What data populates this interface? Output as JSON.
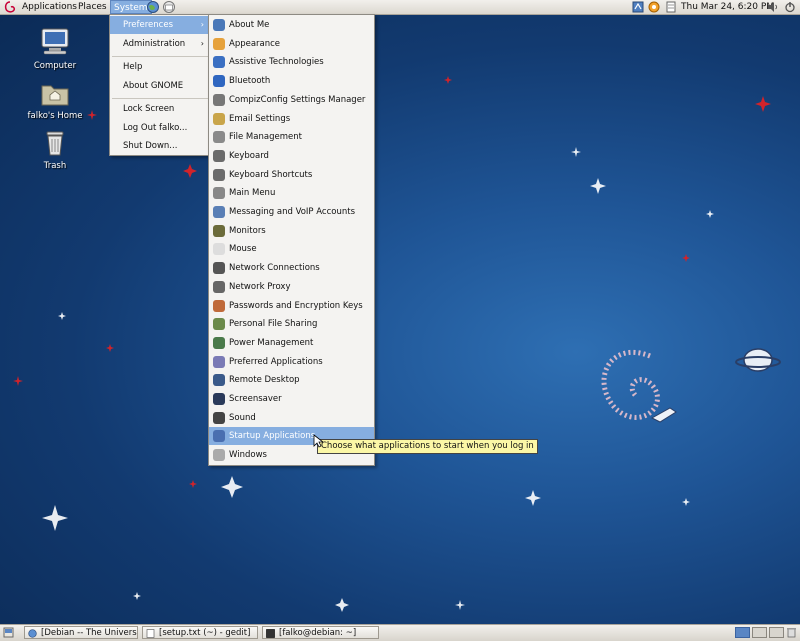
{
  "topbar": {
    "menus": [
      "Applications",
      "Places",
      "System"
    ],
    "clock": "Thu Mar 24,  6:20 PM"
  },
  "desktop_icons": [
    {
      "label": "Computer",
      "icon": "computer-icon"
    },
    {
      "label": "falko's Home",
      "icon": "home-folder-icon"
    },
    {
      "label": "Trash",
      "icon": "trash-icon"
    }
  ],
  "system_menu": {
    "items": [
      "Preferences",
      "Administration",
      "Help",
      "About GNOME",
      "Lock Screen",
      "Log Out falko...",
      "Shut Down..."
    ]
  },
  "preferences_menu": {
    "items": [
      "About Me",
      "Appearance",
      "Assistive Technologies",
      "Bluetooth",
      "CompizConfig Settings Manager",
      "Email Settings",
      "File Management",
      "Keyboard",
      "Keyboard Shortcuts",
      "Main Menu",
      "Messaging and VoIP Accounts",
      "Monitors",
      "Mouse",
      "Network Connections",
      "Network Proxy",
      "Passwords and Encryption Keys",
      "Personal File Sharing",
      "Power Management",
      "Preferred Applications",
      "Remote Desktop",
      "Screensaver",
      "Sound",
      "Startup Applications",
      "Windows"
    ],
    "highlighted": "Startup Applications"
  },
  "tooltip": "Choose what applications to start when you log in",
  "taskbar": {
    "tasks": [
      "[Debian -- The Univers...",
      "[setup.txt (~) - gedit]",
      "[falko@debian: ~]"
    ]
  },
  "colors": {
    "highlight": "#86aee0",
    "desktop_blue": "#1f5596",
    "tooltip_bg": "#fbf7a6"
  }
}
